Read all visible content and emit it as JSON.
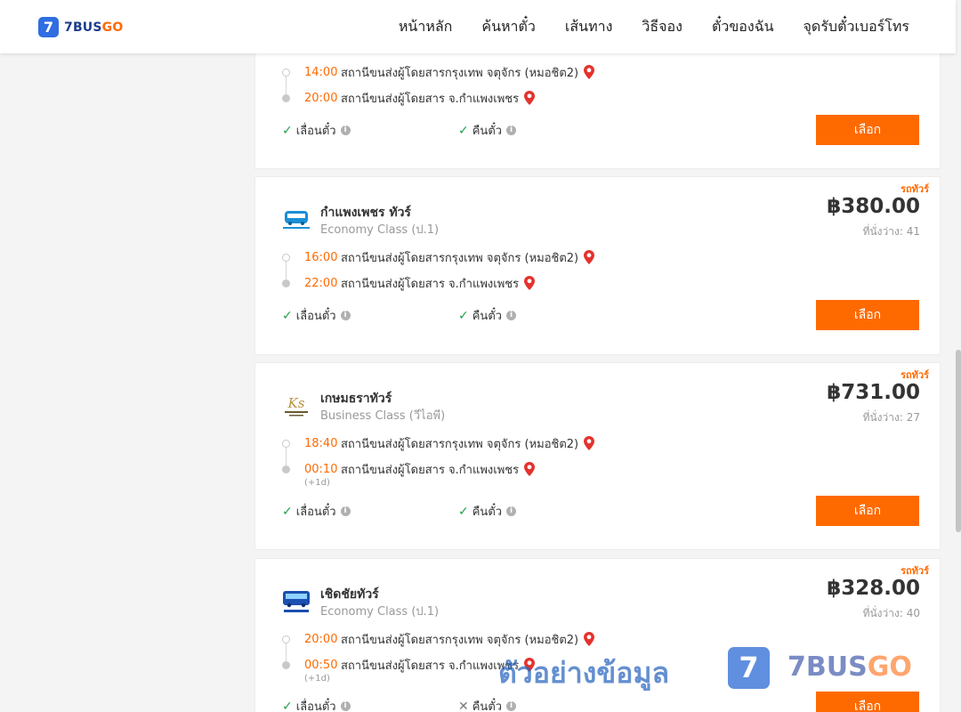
{
  "header": {
    "logo_mark": "7",
    "logo_text_blue": "7BUS",
    "logo_text_orange": "GO",
    "nav": [
      "หน้าหลัก",
      "ค้นหาตั๋ว",
      "เส้นทาง",
      "วิธีจอง",
      "ตั๋วของฉัน",
      "จุดรับตั๋วเบอร์โทร"
    ]
  },
  "colors": {
    "accent": "#ff6a00",
    "brand_blue": "#2f6de1",
    "check_green": "#21a04a",
    "pin_red": "#e5322d"
  },
  "labels": {
    "select": "เลือก",
    "reschedule": "เลื่อนตั๋ว",
    "refund": "คืนตั๋ว",
    "info_icon": "i"
  },
  "cards": [
    {
      "depart_time": "14:00",
      "depart_station": "สถานีขนส่งผู้โดยสารกรุงเทพ จตุจักร (หมอชิต2)",
      "arrive_time": "20:00",
      "arrive_station": "สถานีขนส่งผู้โดยสาร จ.กำแพงเพชร",
      "reschedule_ok": true,
      "refund_ok": true
    },
    {
      "tag": "รถทัวร์",
      "operator": "กำแพงเพชร ทัวร์",
      "class": "Economy Class (ป.1)",
      "price": "฿380.00",
      "seats": "ที่นั่งว่าง: 41",
      "depart_time": "16:00",
      "depart_station": "สถานีขนส่งผู้โดยสารกรุงเทพ จตุจักร (หมอชิต2)",
      "arrive_time": "22:00",
      "arrive_station": "สถานีขนส่งผู้โดยสาร จ.กำแพงเพชร",
      "reschedule_ok": true,
      "refund_ok": true
    },
    {
      "tag": "รถทัวร์",
      "operator": "เกษมธราทัวร์",
      "class": "Business Class (วีไอพี)",
      "price": "฿731.00",
      "seats": "ที่นั่งว่าง: 27",
      "depart_time": "18:40",
      "depart_station": "สถานีขนส่งผู้โดยสารกรุงเทพ จตุจักร (หมอชิต2)",
      "arrive_time": "00:10",
      "arrive_note": "(+1d)",
      "arrive_station": "สถานีขนส่งผู้โดยสาร จ.กำแพงเพชร",
      "reschedule_ok": true,
      "refund_ok": true
    },
    {
      "tag": "รถทัวร์",
      "operator": "เชิดชัยทัวร์",
      "class": "Economy Class (ป.1)",
      "price": "฿328.00",
      "seats": "ที่นั่งว่าง: 40",
      "depart_time": "20:00",
      "depart_station": "สถานีขนส่งผู้โดยสารกรุงเทพ จตุจักร (หมอชิต2)",
      "arrive_time": "00:50",
      "arrive_note": "(+1d)",
      "arrive_station": "สถานีขนส่งผู้โดยสาร จ.กำแพงเพชร",
      "reschedule_ok": true,
      "refund_ok": false
    }
  ],
  "watermark": {
    "text": "ตัวอย่างข้อมูล",
    "mark": "7",
    "brand_blue": "7BUS",
    "brand_orange": "GO"
  }
}
